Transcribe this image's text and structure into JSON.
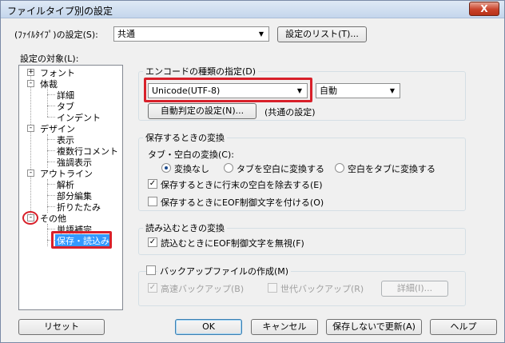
{
  "window": {
    "title": "ファイルタイプ別の設定",
    "close_label": "X"
  },
  "filetype": {
    "label": "(ﾌｧｲﾙﾀｲﾌﾟ)の設定(S):",
    "value": "共通",
    "list_button": "設定のリスト(T)..."
  },
  "tree": {
    "label": "設定の対象(L):",
    "nodes": [
      {
        "label": "フォント",
        "level": 0,
        "expander": "+"
      },
      {
        "label": "体裁",
        "level": 0,
        "expander": "-"
      },
      {
        "label": "詳細",
        "level": 1
      },
      {
        "label": "タブ",
        "level": 1
      },
      {
        "label": "インデント",
        "level": 1
      },
      {
        "label": "デザイン",
        "level": 0,
        "expander": "-"
      },
      {
        "label": "表示",
        "level": 1
      },
      {
        "label": "複数行コメント",
        "level": 1
      },
      {
        "label": "強調表示",
        "level": 1
      },
      {
        "label": "アウトライン",
        "level": 0,
        "expander": "-"
      },
      {
        "label": "解析",
        "level": 1
      },
      {
        "label": "部分編集",
        "level": 1
      },
      {
        "label": "折りたたみ",
        "level": 1
      },
      {
        "label": "その他",
        "level": 0,
        "expander": "-"
      },
      {
        "label": "単語補完",
        "level": 1
      },
      {
        "label": "保存・読込み",
        "level": 1,
        "selected": true
      }
    ]
  },
  "encode": {
    "group_title": "エンコードの種類の指定(D)",
    "encoding_value": "Unicode(UTF-8)",
    "mode_value": "自動",
    "auto_button": "自動判定の設定(N)...",
    "common_note": "(共通の設定)"
  },
  "save": {
    "group_title": "保存するときの変換",
    "tab_label": "タブ・空白の変換(C):",
    "radios": [
      {
        "label": "変換なし",
        "checked": true
      },
      {
        "label": "タブを空白に変換する",
        "checked": false
      },
      {
        "label": "空白をタブに変換する",
        "checked": false
      }
    ],
    "checks": [
      {
        "label": "保存するときに行末の空白を除去する(E)",
        "checked": true
      },
      {
        "label": "保存するときにEOF制御文字を付ける(O)",
        "checked": false
      }
    ]
  },
  "load": {
    "group_title": "読み込むときの変換",
    "check": {
      "label": "読込むときにEOF制御文字を無視(F)",
      "checked": true
    }
  },
  "backup": {
    "check": {
      "label": "バックアップファイルの作成(M)",
      "checked": false
    },
    "fast": {
      "label": "高速バックアップ(B)",
      "checked": true
    },
    "gen": {
      "label": "世代バックアップ(R)",
      "checked": false
    },
    "detail_button": "詳細(I)..."
  },
  "footer": {
    "reset": "リセット",
    "ok": "OK",
    "cancel": "キャンセル",
    "update": "保存しないで更新(A)",
    "help": "ヘルプ"
  },
  "colors": {
    "highlight": "#d8202a",
    "selection": "#3399ff"
  }
}
